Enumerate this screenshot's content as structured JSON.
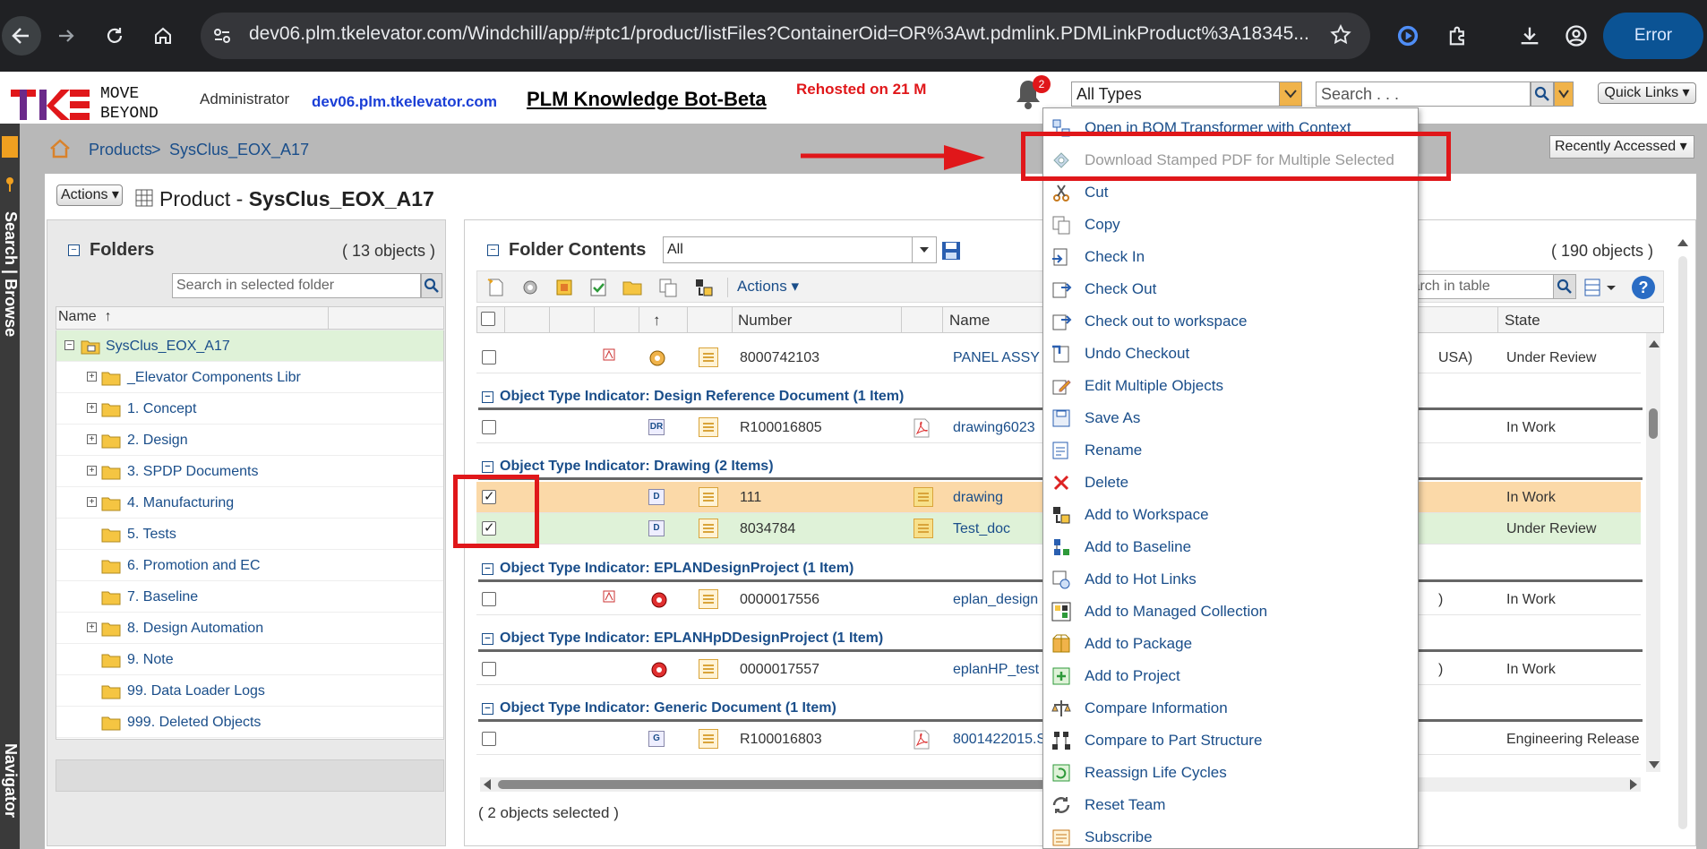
{
  "browser": {
    "url": "dev06.plm.tkelevator.com/Windchill/app/#ptc1/product/listFiles?ContainerOid=OR%3Awt.pdmlink.PDMLinkProduct%3A18345...",
    "error_label": "Error"
  },
  "header": {
    "logo_text": "TKE",
    "motto_line1": "MOVE",
    "motto_line2": "BEYOND",
    "user": "Administrator",
    "host": "dev06.plm.tkelevator.com",
    "bot_title": "PLM Knowledge Bot-Beta",
    "rehosted": "Rehosted on 21 M",
    "notification_count": "2",
    "type_filter": "All Types",
    "search_placeholder": "Search . . .",
    "quick_links": "Quick Links"
  },
  "navigator": {
    "search_label": "Search | Browse",
    "navigator_label": "Navigator"
  },
  "breadcrumb": {
    "products": "Products",
    "separator": ">",
    "current": "SysClus_EOX_A17",
    "recently_accessed": "Recently Accessed"
  },
  "page": {
    "actions": "Actions",
    "title_prefix": "Product - ",
    "title_name": "SysClus_EOX_A17"
  },
  "folders": {
    "title": "Folders",
    "count": "( 13 objects )",
    "search_placeholder": "Search in selected folder",
    "column_name": "Name",
    "sort_indicator": "↑",
    "items": [
      {
        "label": "SysClus_EOX_A17"
      },
      {
        "label": "_Elevator Components Libr"
      },
      {
        "label": "1. Concept"
      },
      {
        "label": "2. Design"
      },
      {
        "label": "3. SPDP Documents"
      },
      {
        "label": "4. Manufacturing"
      },
      {
        "label": "5. Tests"
      },
      {
        "label": "6. Promotion and EC"
      },
      {
        "label": "7. Baseline"
      },
      {
        "label": "8. Design Automation"
      },
      {
        "label": "9. Note"
      },
      {
        "label": "99. Data Loader Logs"
      },
      {
        "label": "999. Deleted Objects"
      }
    ]
  },
  "contents": {
    "title": "Folder Contents",
    "filter": "All",
    "count": "( 190 objects )",
    "actions": "Actions",
    "table_search_placeholder": "Search in table",
    "columns": {
      "number": "Number",
      "name": "Name",
      "state": "State",
      "sort_indicator": "↑"
    },
    "row_top": {
      "number": "8000742103",
      "name": "PANEL ASSY",
      "extra": "USA)",
      "state": "Under Review"
    },
    "groups": [
      {
        "label": "Object Type Indicator: Design Reference Document (1 Item)"
      },
      {
        "label": "Object Type Indicator: Drawing (2 Items)"
      },
      {
        "label": "Object Type Indicator: EPLANDesignProject (1 Item)"
      },
      {
        "label": "Object Type Indicator: EPLANHpDDesignProject (1 Item)"
      },
      {
        "label": "Object Type Indicator: Generic Document (1 Item)"
      }
    ],
    "rows": [
      {
        "number": "R100016805",
        "name": "drawing6023",
        "state": "In Work",
        "badge": "DR"
      },
      {
        "number": "111",
        "name": "drawing",
        "state": "In Work",
        "badge": "D"
      },
      {
        "number": "8034784",
        "name": "Test_doc",
        "state": "Under Review",
        "badge": "D"
      },
      {
        "number": "0000017556",
        "name": "eplan_design",
        "extra": ")",
        "state": "In Work"
      },
      {
        "number": "0000017557",
        "name": "eplanHP_test",
        "extra": ")",
        "state": "In Work"
      },
      {
        "number": "R100016803",
        "name": "8001422015.S",
        "state": "Engineering Release",
        "badge": "G"
      }
    ],
    "selected_status": "( 2 objects selected )",
    "row_colors": {
      "selected_orange": "#fbd9a8",
      "selected_green": "#dff2d8"
    }
  },
  "context_menu": {
    "items": [
      {
        "label": "Open in BOM Transformer with Context",
        "icon": "bom-icon"
      },
      {
        "label": "Download Stamped PDF for Multiple Selected",
        "icon": "stamp-icon",
        "disabled": true
      },
      {
        "label": "Cut",
        "icon": "scissors-icon"
      },
      {
        "label": "Copy",
        "icon": "copy-icon"
      },
      {
        "label": "Check In",
        "icon": "check-in-icon"
      },
      {
        "label": "Check Out",
        "icon": "check-out-icon"
      },
      {
        "label": "Check out to workspace",
        "icon": "check-out-workspace-icon"
      },
      {
        "label": "Undo Checkout",
        "icon": "undo-checkout-icon"
      },
      {
        "label": "Edit Multiple Objects",
        "icon": "edit-icon"
      },
      {
        "label": "Save As",
        "icon": "save-as-icon"
      },
      {
        "label": "Rename",
        "icon": "rename-icon"
      },
      {
        "label": "Delete",
        "icon": "delete-icon"
      },
      {
        "label": "Add to Workspace",
        "icon": "workspace-icon"
      },
      {
        "label": "Add to Baseline",
        "icon": "baseline-icon"
      },
      {
        "label": "Add to Hot Links",
        "icon": "hotlinks-icon"
      },
      {
        "label": "Add to Managed Collection",
        "icon": "collection-icon"
      },
      {
        "label": "Add to Package",
        "icon": "package-icon"
      },
      {
        "label": "Add to Project",
        "icon": "project-icon"
      },
      {
        "label": "Compare Information",
        "icon": "compare-icon"
      },
      {
        "label": "Compare to Part Structure",
        "icon": "structure-icon"
      },
      {
        "label": "Reassign Life Cycles",
        "icon": "lifecycle-icon"
      },
      {
        "label": "Reset Team",
        "icon": "team-icon"
      },
      {
        "label": "Subscribe",
        "icon": "subscribe-icon"
      }
    ]
  },
  "colors": {
    "annotation_red": "#e0171a",
    "link_blue": "#1a4e8a",
    "brand_red": "#e0171a",
    "brand_purple": "#6b2a8a"
  }
}
